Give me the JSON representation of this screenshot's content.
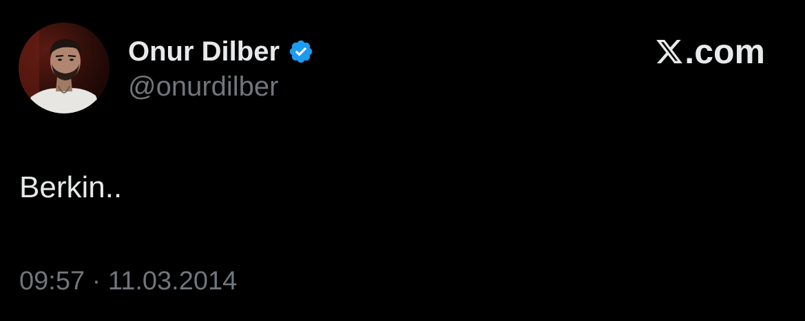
{
  "author": {
    "display_name": "Onur Dilber",
    "handle": "@onurdilber",
    "verified": true,
    "verified_icon": "verified-badge-icon",
    "avatar": "profile-photo"
  },
  "brand": {
    "logo_icon": "x-logo-icon",
    "text": ".com"
  },
  "tweet": {
    "text": "Berkin..",
    "time": "09:57",
    "separator": " · ",
    "date": "11.03.2014"
  },
  "colors": {
    "background": "#000000",
    "primary_text": "#e7e9ea",
    "secondary_text": "#71767b",
    "verified_blue": "#1d9bf0"
  }
}
